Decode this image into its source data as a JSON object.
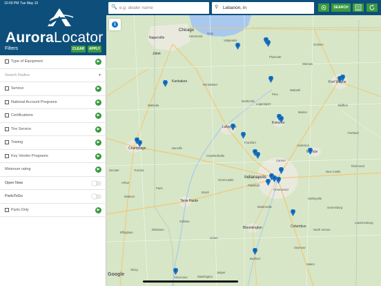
{
  "status": {
    "time": "10:00 PM",
    "date": "Tue May 10"
  },
  "sidebar": {
    "logo_word1": "Aurora",
    "logo_word2": "Locator",
    "filters_label": "Filters",
    "clear_label": "CLEAR",
    "apply_label": "APPLY",
    "rows": [
      {
        "label": "Type of Equipment"
      },
      {
        "label": "Search Radius"
      },
      {
        "label": "Service"
      },
      {
        "label": "National Account Programs"
      },
      {
        "label": "Certifications"
      },
      {
        "label": "Tire Service"
      },
      {
        "label": "Towing"
      },
      {
        "label": "Key Vendor Programs"
      },
      {
        "label": "Minimum rating"
      },
      {
        "label": "Open Now"
      },
      {
        "label": "PartsToGo"
      },
      {
        "label": "Parts Only"
      }
    ]
  },
  "topbar": {
    "dealer_placeholder": "e.g. dealer name",
    "location_value": "Lebanon, in",
    "search_label": "SEARCH"
  },
  "map": {
    "cities": {
      "chicago": "Chicago",
      "naperville": "Naperville",
      "joliet": "Joliet",
      "kankakee": "Kankakee",
      "fort_wayne": "Fort Wayne",
      "indianapolis": "Indianapolis",
      "lafayette": "Lafayette",
      "champaign": "Champaign",
      "danville": "Danville",
      "crawfordsville": "Crawfordsville",
      "terre_haute": "Terre Haute",
      "bloomington": "Bloomington",
      "columbus": "Columbus",
      "kokomo": "Kokomo",
      "logansport": "Logansport",
      "muncie": "Muncie",
      "greenwood": "Greenwood",
      "carmel": "Carmel",
      "plainfield": "Plainfield",
      "seymour": "Seymour",
      "bedford": "Bedford",
      "vincennes": "Vincennes",
      "washington": "Washington",
      "decatur": "Decatur",
      "mattoon": "Mattoon",
      "effingham": "Effingham",
      "olney": "Olney",
      "paris": "Paris",
      "arthur": "Arthur",
      "tuscola": "Tuscola",
      "martinsville": "Martinsville",
      "shelbyville": "Shelbyville",
      "richmond": "Richmond",
      "peru": "Peru",
      "wabash": "Wabash",
      "valparaiso": "Valparaiso",
      "hammond": "Hammond",
      "gary": "Gary",
      "robinson": "Robinson",
      "sullivan": "Sullivan",
      "jasper": "Jasper",
      "new_castle": "New Castle",
      "anderson": "Anderson",
      "marion": "Marion",
      "frankfort": "Frankfort",
      "brazil": "Brazil",
      "greencastle": "Greencastle",
      "watseka": "Watseka",
      "rensselaer": "Rensselaer",
      "monticello": "Monticello",
      "plymouth": "Plymouth",
      "warsaw": "Warsaw",
      "bluffton": "Bluffton",
      "portland": "Portland",
      "greensburg": "Greensburg",
      "lawrenceburg": "Lawrenceburg",
      "north_vernon": "North Vernon",
      "linton": "Linton",
      "salem": "Salem",
      "goshen": "Goshen"
    },
    "google": "Google"
  }
}
